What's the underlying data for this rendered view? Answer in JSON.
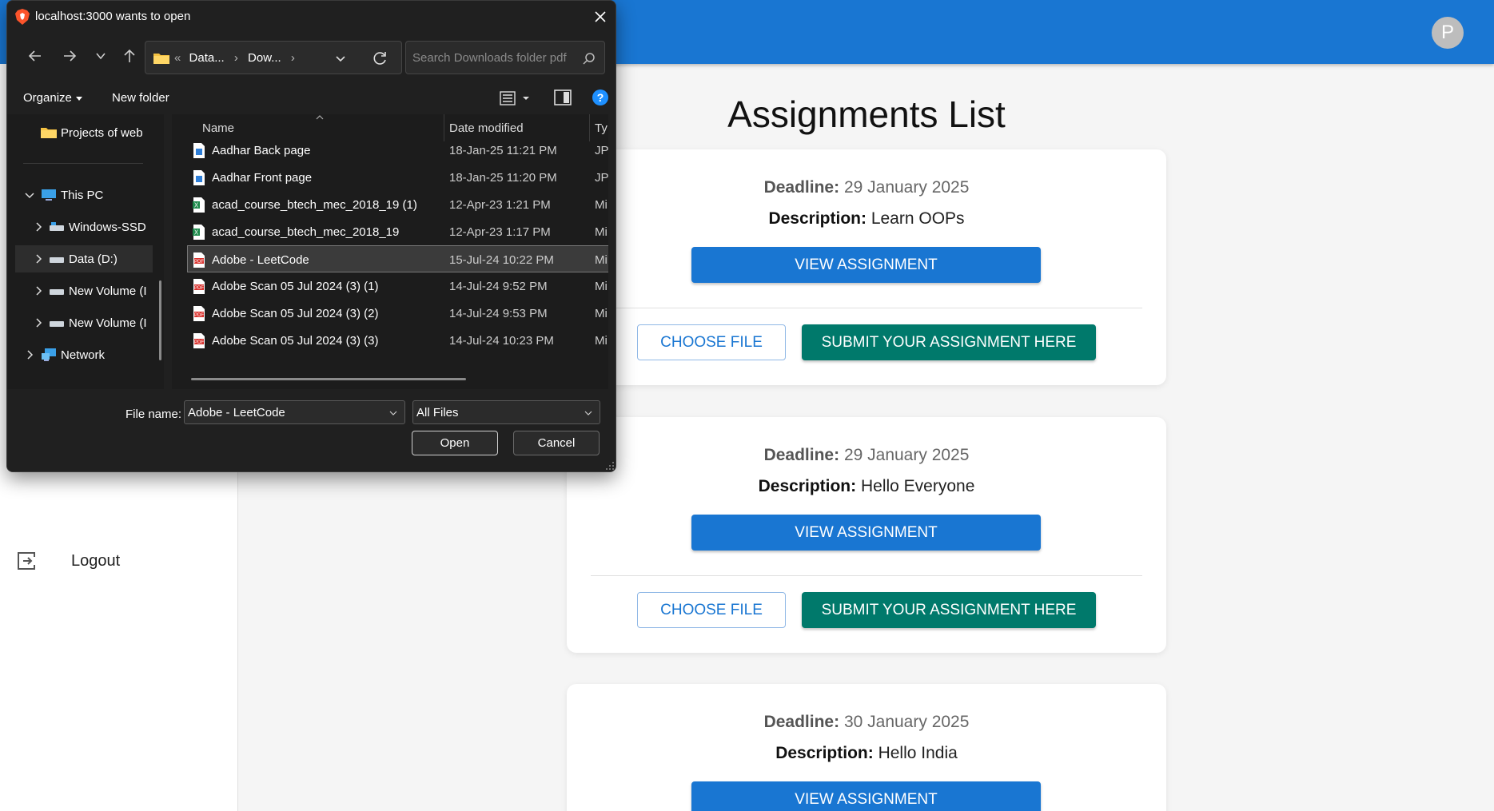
{
  "app": {
    "avatar_initial": "P",
    "page_title": "Assignments List",
    "logout_label": "Logout",
    "colors": {
      "appbar": "#1976d2",
      "primary": "#1976d2",
      "submit": "#00796b"
    },
    "assignments": [
      {
        "deadline_label": "Deadline:",
        "deadline": "29 January 2025",
        "description_label": "Description:",
        "description": "Learn OOPs",
        "view_label": "VIEW ASSIGNMENT",
        "choose_label": "CHOOSE FILE",
        "submit_label": "SUBMIT YOUR ASSIGNMENT HERE"
      },
      {
        "deadline_label": "Deadline:",
        "deadline": "29 January 2025",
        "description_label": "Description:",
        "description": "Hello Everyone",
        "view_label": "VIEW ASSIGNMENT",
        "choose_label": "CHOOSE FILE",
        "submit_label": "SUBMIT YOUR ASSIGNMENT HERE"
      },
      {
        "deadline_label": "Deadline:",
        "deadline": "30 January 2025",
        "description_label": "Description:",
        "description": "Hello India",
        "view_label": "VIEW ASSIGNMENT"
      }
    ]
  },
  "dialog": {
    "title": "localhost:3000 wants to open",
    "breadcrumb": {
      "overflow": "«",
      "items": [
        "Data...",
        "Dow..."
      ]
    },
    "search_placeholder": "Search Downloads folder pdf",
    "toolbar": {
      "organize": "Organize",
      "new_folder": "New folder"
    },
    "nav_items": [
      {
        "label": "Projects of web",
        "icon": "folder-icon"
      },
      {
        "label": "This PC",
        "icon": "pc-icon",
        "expanded": true
      },
      {
        "label": "Windows-SSD",
        "icon": "drive-icon"
      },
      {
        "label": "Data (D:)",
        "icon": "drive-icon",
        "selected": true
      },
      {
        "label": "New Volume (I",
        "icon": "drive-icon"
      },
      {
        "label": "New Volume (I",
        "icon": "drive-icon"
      },
      {
        "label": "Network",
        "icon": "network-icon"
      }
    ],
    "columns": {
      "name": "Name",
      "date": "Date modified",
      "type": "Ty"
    },
    "files": [
      {
        "name": "Aadhar Back page",
        "date": "18-Jan-25 11:21 PM",
        "type": "JPG",
        "icon": "image-file-icon"
      },
      {
        "name": "Aadhar Front page",
        "date": "18-Jan-25 11:20 PM",
        "type": "JPG",
        "icon": "image-file-icon"
      },
      {
        "name": "acad_course_btech_mec_2018_19 (1)",
        "date": "12-Apr-23 1:21 PM",
        "type": "Mi",
        "icon": "excel-file-icon"
      },
      {
        "name": "acad_course_btech_mec_2018_19",
        "date": "12-Apr-23 1:17 PM",
        "type": "Mi",
        "icon": "excel-file-icon"
      },
      {
        "name": "Adobe - LeetCode",
        "date": "15-Jul-24 10:22 PM",
        "type": "Mi",
        "icon": "pdf-file-icon",
        "selected": true
      },
      {
        "name": "Adobe Scan 05 Jul 2024 (3) (1)",
        "date": "14-Jul-24 9:52 PM",
        "type": "Mi",
        "icon": "pdf-file-icon"
      },
      {
        "name": "Adobe Scan 05 Jul 2024 (3) (2)",
        "date": "14-Jul-24 9:53 PM",
        "type": "Mi",
        "icon": "pdf-file-icon"
      },
      {
        "name": "Adobe Scan 05 Jul 2024 (3) (3)",
        "date": "14-Jul-24 10:23 PM",
        "type": "Mi",
        "icon": "pdf-file-icon"
      }
    ],
    "file_name_label": "File name:",
    "file_name_value": "Adobe - LeetCode",
    "file_type_value": "All Files",
    "open_label": "Open",
    "cancel_label": "Cancel"
  }
}
